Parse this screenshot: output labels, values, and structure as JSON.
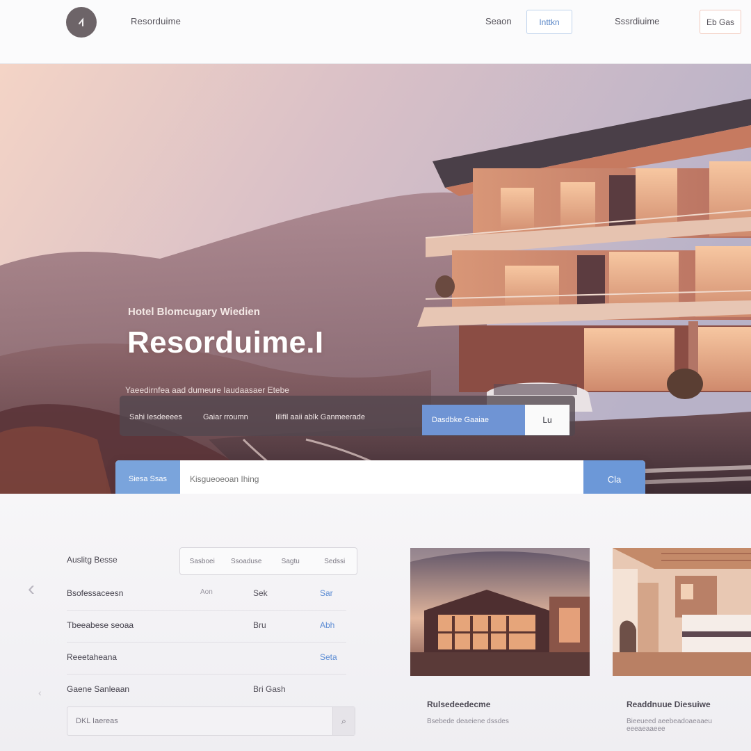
{
  "nav": {
    "logo_mark": "1",
    "brand": "Resorduime",
    "links": [
      "Seaon",
      "Inttkn",
      "Sssrdiuime"
    ],
    "cta": "Eb Gas"
  },
  "hero": {
    "eyebrow": "Hotel Blomcugary Wiedien",
    "title": "Resorduime.I",
    "subtitle": "Yaeedirnfea aad dumeure Iaudaasaer Etebe",
    "booking": {
      "text1": "Sahi Iesdeeees",
      "text2": "Gaiar rroumn",
      "text3": "Iilifil aaii ablk Ganmeerade",
      "field": "Dasdbke Gaaiae",
      "button": "Lu"
    },
    "search": {
      "label": "Siesa Ssas",
      "placeholder": "Kisgueoeoan Ihing",
      "button": "Cla"
    }
  },
  "filters": {
    "label": "Auslitg Besse",
    "segments": [
      "Sasboei",
      "Ssoaduse",
      "Sagtu",
      "Sedssi"
    ]
  },
  "rows": [
    {
      "name": "Bsofessaceesn",
      "c1": "Aon",
      "c2": "Sek",
      "c3": "Sar"
    },
    {
      "name": "Tbeeabese seoaa",
      "c1": "",
      "c2": "Bru",
      "c3": "Abh"
    },
    {
      "name": "Reeetaheana",
      "c1": "",
      "c2": "",
      "c3": "Seta"
    },
    {
      "name": "Gaene Sanleaan",
      "c1": "",
      "c2": "Bri Gash",
      "c3": ""
    }
  ],
  "bottom_input": {
    "text": "DKL Iaereas",
    "button_icon": "search-icon"
  },
  "cards": [
    {
      "title": "Rulsedeedecme",
      "subtitle": "Bsebede deaeiene dssdes"
    },
    {
      "title": "Readdnuue Diesuiwe",
      "subtitle": "Bieeueed aeebeadoaeaaeu eeeaeaaeee"
    }
  ],
  "colors": {
    "accent_blue": "#6c98d8",
    "nav_bg": "#fbfbfc",
    "hero_warm": "#e8b9a4"
  }
}
